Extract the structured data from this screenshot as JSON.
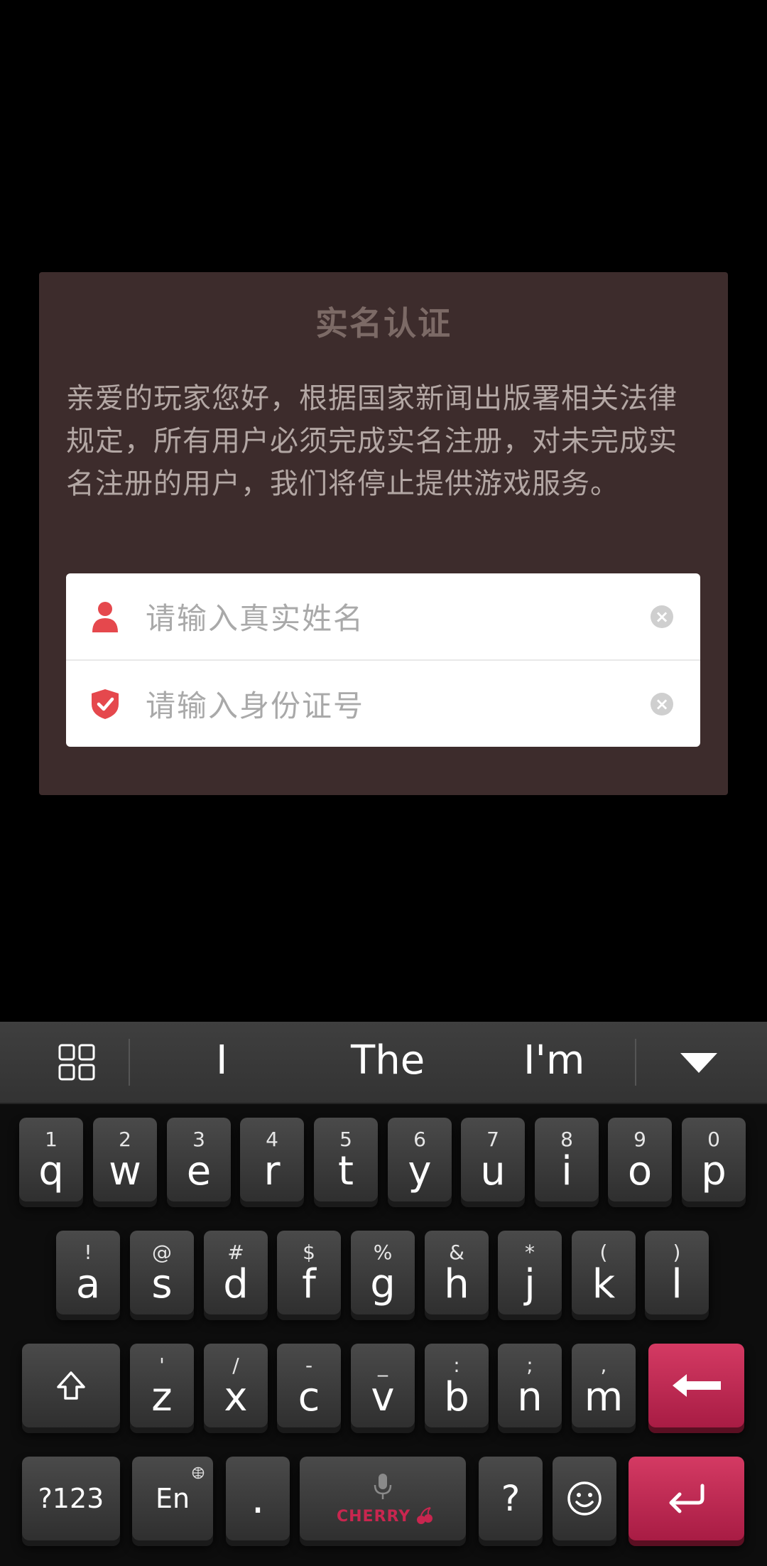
{
  "dialog": {
    "title": "实名认证",
    "message": "亲爱的玩家您好，根据国家新闻出版署相关法律规定，所有用户必须完成实名注册，对未完成实名注册的用户，我们将停止提供游戏服务。",
    "name_placeholder": "请输入真实姓名",
    "id_placeholder": "请输入身份证号",
    "clear_glyph": "×",
    "accent_color": "#e5484d"
  },
  "keyboard": {
    "suggestions": [
      "I",
      "The",
      "I'm"
    ],
    "row1": [
      {
        "main": "q",
        "sub": "1"
      },
      {
        "main": "w",
        "sub": "2"
      },
      {
        "main": "e",
        "sub": "3"
      },
      {
        "main": "r",
        "sub": "4"
      },
      {
        "main": "t",
        "sub": "5"
      },
      {
        "main": "y",
        "sub": "6"
      },
      {
        "main": "u",
        "sub": "7"
      },
      {
        "main": "i",
        "sub": "8"
      },
      {
        "main": "o",
        "sub": "9"
      },
      {
        "main": "p",
        "sub": "0"
      }
    ],
    "row2": [
      {
        "main": "a",
        "sub": "!"
      },
      {
        "main": "s",
        "sub": "@"
      },
      {
        "main": "d",
        "sub": "#"
      },
      {
        "main": "f",
        "sub": "$"
      },
      {
        "main": "g",
        "sub": "%"
      },
      {
        "main": "h",
        "sub": "&"
      },
      {
        "main": "j",
        "sub": "*"
      },
      {
        "main": "k",
        "sub": "("
      },
      {
        "main": "l",
        "sub": ")"
      }
    ],
    "row3": [
      {
        "main": "z",
        "sub": "'"
      },
      {
        "main": "x",
        "sub": "/"
      },
      {
        "main": "c",
        "sub": "-"
      },
      {
        "main": "v",
        "sub": "_"
      },
      {
        "main": "b",
        "sub": ":"
      },
      {
        "main": "n",
        "sub": ";"
      },
      {
        "main": "m",
        "sub": ","
      }
    ],
    "symbols_label": "?123",
    "lang_label": "En",
    "period_label": ".",
    "question_label": "?",
    "brand_label": "CHERRY",
    "accent_color": "#c8264f"
  }
}
